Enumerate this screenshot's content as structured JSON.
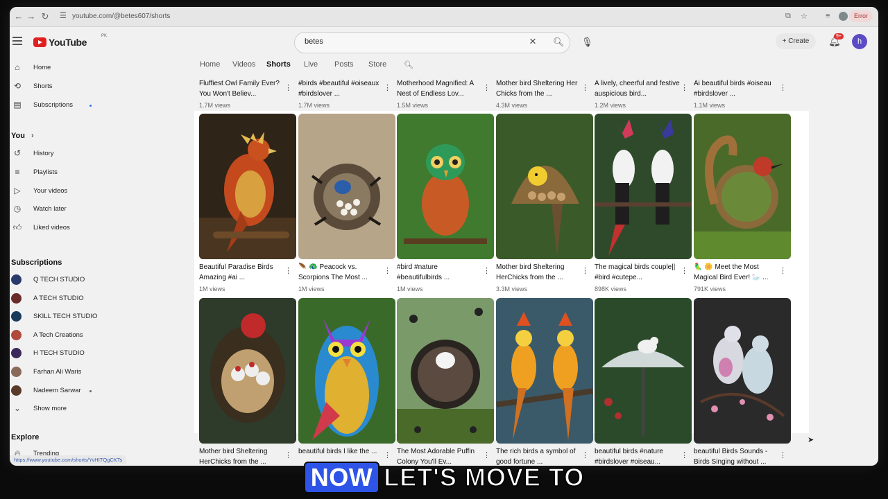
{
  "browser": {
    "url": "youtube.com/@betes607/shorts",
    "error_label": "Error",
    "status_url": "https://www.youtube.com/shorts/YvHITQgCKTs"
  },
  "header": {
    "logo_text": "YouTube",
    "logo_country": "PK",
    "search_value": "betes",
    "create_label": "Create",
    "notif_count": "9+",
    "avatar_letter": "h"
  },
  "sidebar": {
    "main": [
      {
        "label": "Home",
        "icon": "home-icon"
      },
      {
        "label": "Shorts",
        "icon": "shorts-icon"
      },
      {
        "label": "Subscriptions",
        "icon": "subscriptions-icon"
      }
    ],
    "you_label": "You",
    "you": [
      {
        "label": "History",
        "icon": "history-icon"
      },
      {
        "label": "Playlists",
        "icon": "playlists-icon"
      },
      {
        "label": "Your videos",
        "icon": "your-videos-icon"
      },
      {
        "label": "Watch later",
        "icon": "watch-later-icon"
      },
      {
        "label": "Liked videos",
        "icon": "liked-videos-icon"
      }
    ],
    "subs_label": "Subscriptions",
    "subs": [
      {
        "label": "Q TECH STUDIO",
        "color": "#2a3a6a"
      },
      {
        "label": "A TECH STUDIO",
        "color": "#6a2a2a"
      },
      {
        "label": "SKILL TECH STUDIO",
        "color": "#1a3a5a"
      },
      {
        "label": "A Tech Creations",
        "color": "#b04a3a"
      },
      {
        "label": "H TECH STUDIO",
        "color": "#3a2a5a"
      },
      {
        "label": "Farhan Ali Waris",
        "color": "#8a6a5a"
      },
      {
        "label": "Nadeem Sarwar",
        "color": "#5a3a2a"
      }
    ],
    "show_more": "Show more",
    "explore_label": "Explore",
    "trending": "Trending"
  },
  "tabs": [
    "Home",
    "Videos",
    "Shorts",
    "Live",
    "Posts",
    "Store"
  ],
  "active_tab": "Shorts",
  "row_top": [
    {
      "title": "Fluffiest Owl Family Ever? You Won't Believ...",
      "views": "1.7M views"
    },
    {
      "title": "#birds #beautiful #oiseaux #birdslover ...",
      "views": "1.7M views"
    },
    {
      "title": "Motherhood Magnified: A Nest of Endless Lov...",
      "views": "1.5M views"
    },
    {
      "title": "Mother bird Sheltering Her Chicks from the ...",
      "views": "4.3M views"
    },
    {
      "title": "A lively, cheerful and festive auspicious bird...",
      "views": "1.2M views"
    },
    {
      "title": "Ai beautiful birds #oiseau #birdslover ...",
      "views": "1.1M views"
    }
  ],
  "row_mid": [
    {
      "title": "Beautiful Paradise Birds Amazing #ai ...",
      "views": "1M views"
    },
    {
      "title": "🪶 🦚 Peacock vs. Scorpions The Most ...",
      "views": "1M views"
    },
    {
      "title": "#bird #nature #beautifulbirds ...",
      "views": "1M views"
    },
    {
      "title": "Mother bird Sheltering HerChicks from the ...",
      "views": "3.3M views"
    },
    {
      "title": "The magical birds couple|| #bird #cutepe...",
      "views": "898K views"
    },
    {
      "title": "🦜 🌼 Meet the Most Magical Bird Ever! 🦢 ...",
      "views": "791K views"
    }
  ],
  "row_bottom": [
    {
      "title": "Mother bird Sheltering HerChicks from the ..."
    },
    {
      "title": "beautiful birds I like the ..."
    },
    {
      "title": "The Most Adorable Puffin Colony You'll Ev..."
    },
    {
      "title": "The rich birds a symbol of good fortune ..."
    },
    {
      "title": "beautiful birds #nature #birdslover #oiseau..."
    },
    {
      "title": "beautiful Birds Sounds - Birds Singing without ..."
    }
  ],
  "caption": {
    "highlight": "NOW",
    "rest": "LET'S MOVE TO"
  }
}
